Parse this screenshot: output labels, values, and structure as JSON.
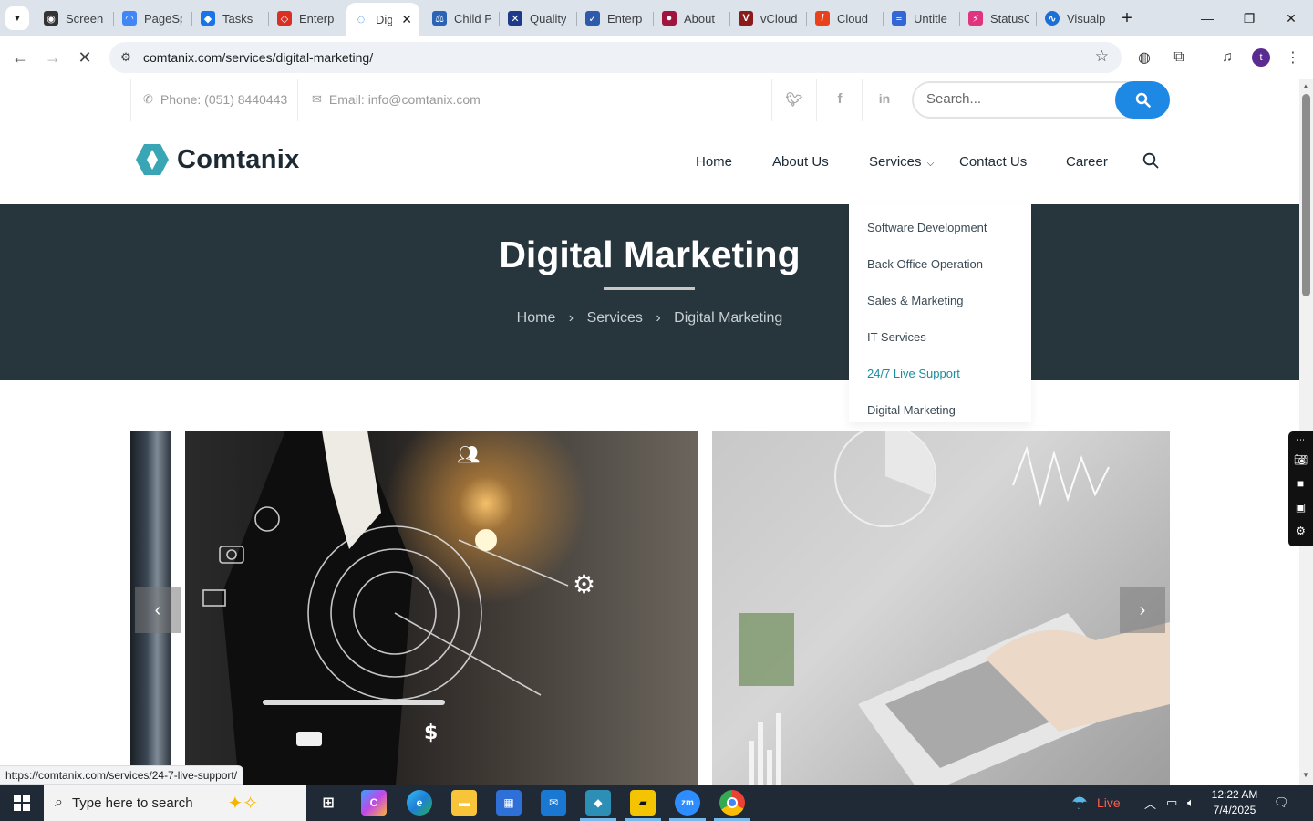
{
  "browser": {
    "tabs": [
      {
        "title": "Screen",
        "fav": "#333"
      },
      {
        "title": "PageSp",
        "fav": "#4285f4"
      },
      {
        "title": "Tasks",
        "fav": "#1a73e8"
      },
      {
        "title": "Enterp",
        "fav": "#d93025"
      },
      {
        "title": "Dig",
        "fav": "#1a73e8",
        "active": true
      },
      {
        "title": "Child P",
        "fav": "#2b63b5"
      },
      {
        "title": "Quality",
        "fav": "#1d3a8a"
      },
      {
        "title": "Enterp",
        "fav": "#2e5aac"
      },
      {
        "title": "About",
        "fav": "#a0153e"
      },
      {
        "title": "vCloud",
        "fav": "#8b1a1a"
      },
      {
        "title": "Cloud",
        "fav": "#e8411b"
      },
      {
        "title": "Untitle",
        "fav": "#3367d6"
      },
      {
        "title": "StatusC",
        "fav": "#e0357e"
      },
      {
        "title": "Visualp",
        "fav": "#1b6fd6"
      }
    ],
    "url": "comtanix.com/services/digital-marketing/",
    "profile_initial": "t",
    "status_url": "https://comtanix.com/services/24-7-live-support/"
  },
  "site": {
    "phone": "Phone: (051) 8440443",
    "email": "Email: info@comtanix.com",
    "search_placeholder": "Search...",
    "logo_text": "Comtanix",
    "nav": {
      "home": "Home",
      "about": "About Us",
      "services": "Services",
      "contact": "Contact Us",
      "career": "Career"
    },
    "dropdown": [
      "Software Development",
      "Back Office Operation",
      "Sales & Marketing",
      "IT Services",
      "24/7 Live Support",
      "Digital Marketing"
    ],
    "hero": {
      "title": "Digital Marketing",
      "crumbs": [
        "Home",
        "Services",
        "Digital Marketing"
      ]
    },
    "colors": {
      "accent": "#1e88e5",
      "hero_bg": "#27363c",
      "link_hover": "#1a8c9c"
    }
  },
  "taskbar": {
    "search_placeholder": "Type here to search",
    "weather_label": "Live",
    "time": "12:22 AM",
    "date": "7/4/2025"
  }
}
